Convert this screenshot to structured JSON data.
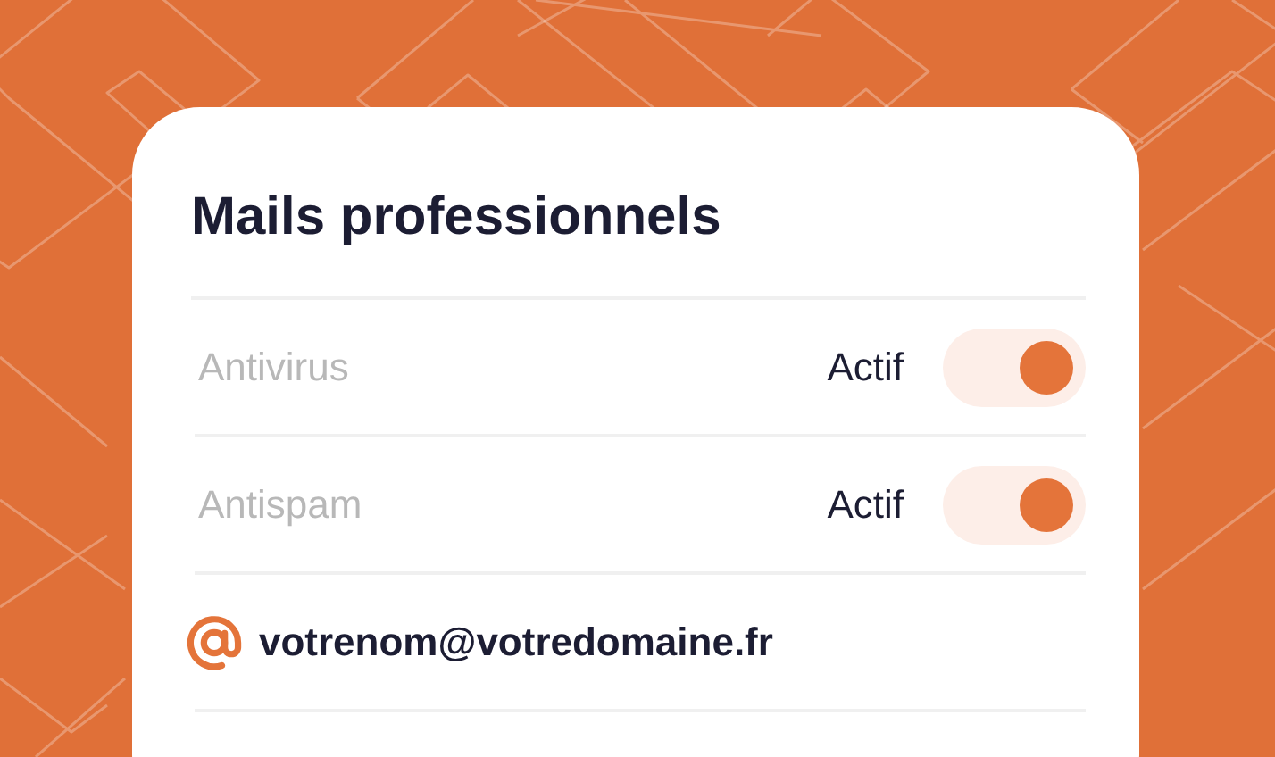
{
  "card": {
    "title": "Mails professionnels",
    "features": [
      {
        "label": "Antivirus",
        "status": "Actif",
        "on": true
      },
      {
        "label": "Antispam",
        "status": "Actif",
        "on": true
      }
    ],
    "email": "votrenom@votredomaine.fr"
  }
}
